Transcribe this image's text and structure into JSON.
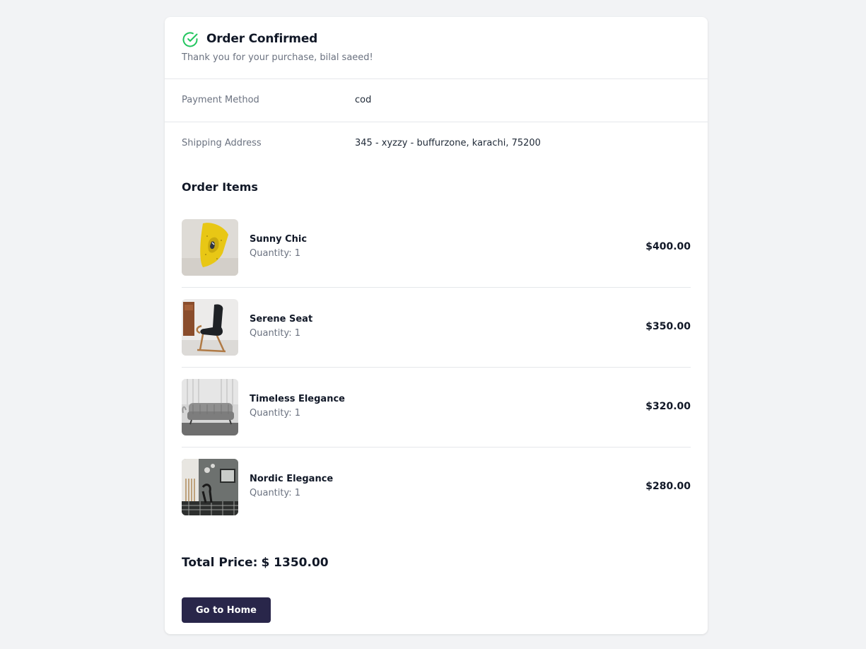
{
  "header": {
    "title": "Order Confirmed",
    "subtitle": "Thank you for your purchase, bilal saeed!",
    "icon": "check-circle-icon",
    "icon_color": "#22c55e"
  },
  "details": [
    {
      "label": "Payment Method",
      "value": "cod"
    },
    {
      "label": "Shipping Address",
      "value": "345 - xyzzy - buffurzone, karachi, 75200"
    }
  ],
  "items_heading": "Order Items",
  "items": [
    {
      "name": "Sunny Chic",
      "quantity": "Quantity: 1",
      "price": "$400.00"
    },
    {
      "name": "Serene Seat",
      "quantity": "Quantity: 1",
      "price": "$350.00"
    },
    {
      "name": "Timeless Elegance",
      "quantity": "Quantity: 1",
      "price": "$320.00"
    },
    {
      "name": "Nordic Elegance",
      "quantity": "Quantity: 1",
      "price": "$280.00"
    }
  ],
  "total": {
    "label": "Total Price:",
    "value": "$ 1350.00"
  },
  "home_button": "Go to Home",
  "colors": {
    "background": "#f2f3f5",
    "accent": "#29264a",
    "success": "#22c55e"
  }
}
